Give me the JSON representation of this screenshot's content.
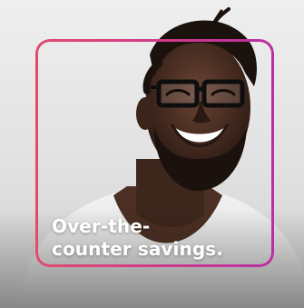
{
  "promo": {
    "headline_line1": "Over-the-",
    "headline_line2": "counter savings."
  },
  "colors": {
    "frame_gradient_start": "#e04b6e",
    "frame_gradient_end": "#b92fa3",
    "headline_text": "#ffffff",
    "background": "#e9e9e9"
  },
  "icons": {
    "photo": "smiling-man-with-glasses-photo"
  }
}
